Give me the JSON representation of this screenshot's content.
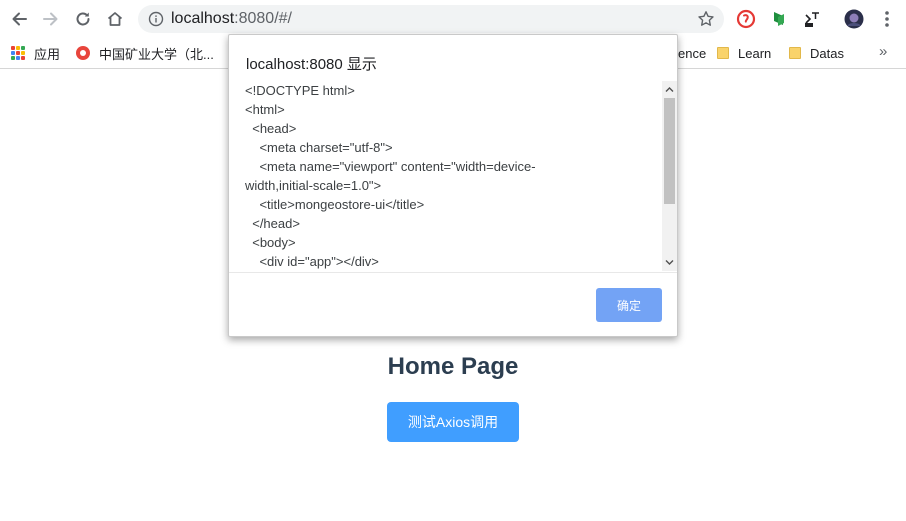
{
  "browser": {
    "url_host": "localhost",
    "url_rest": ":8080/#/"
  },
  "bookmarks": [
    {
      "label": "应用",
      "icon": "apps-grid-icon"
    },
    {
      "label": "中国矿业大学（北...",
      "icon": "cumt-favicon"
    },
    {
      "label": "ence",
      "icon": "folder-icon"
    },
    {
      "label": "Learn",
      "icon": "folder-icon"
    },
    {
      "label": "Datas",
      "icon": "folder-icon"
    }
  ],
  "bookmarks_more": "»",
  "page": {
    "title": "Home Page",
    "axios_button_label": "测试Axios调用"
  },
  "dialog": {
    "title": "localhost:8080 显示",
    "lines": [
      "<!DOCTYPE html>",
      "<html>",
      "  <head>",
      "    <meta charset=\"utf-8\">",
      "    <meta name=\"viewport\" content=\"width=device-",
      "width,initial-scale=1.0\">",
      "    <title>mongeostore-ui</title>",
      "  </head>",
      "  <body>",
      "    <div id=\"app\"></div>"
    ],
    "ok_label": "确定"
  },
  "colors": {
    "primary_button": "#409eff",
    "dialog_ok": "#73a3f5",
    "heading": "#2c3e50"
  }
}
